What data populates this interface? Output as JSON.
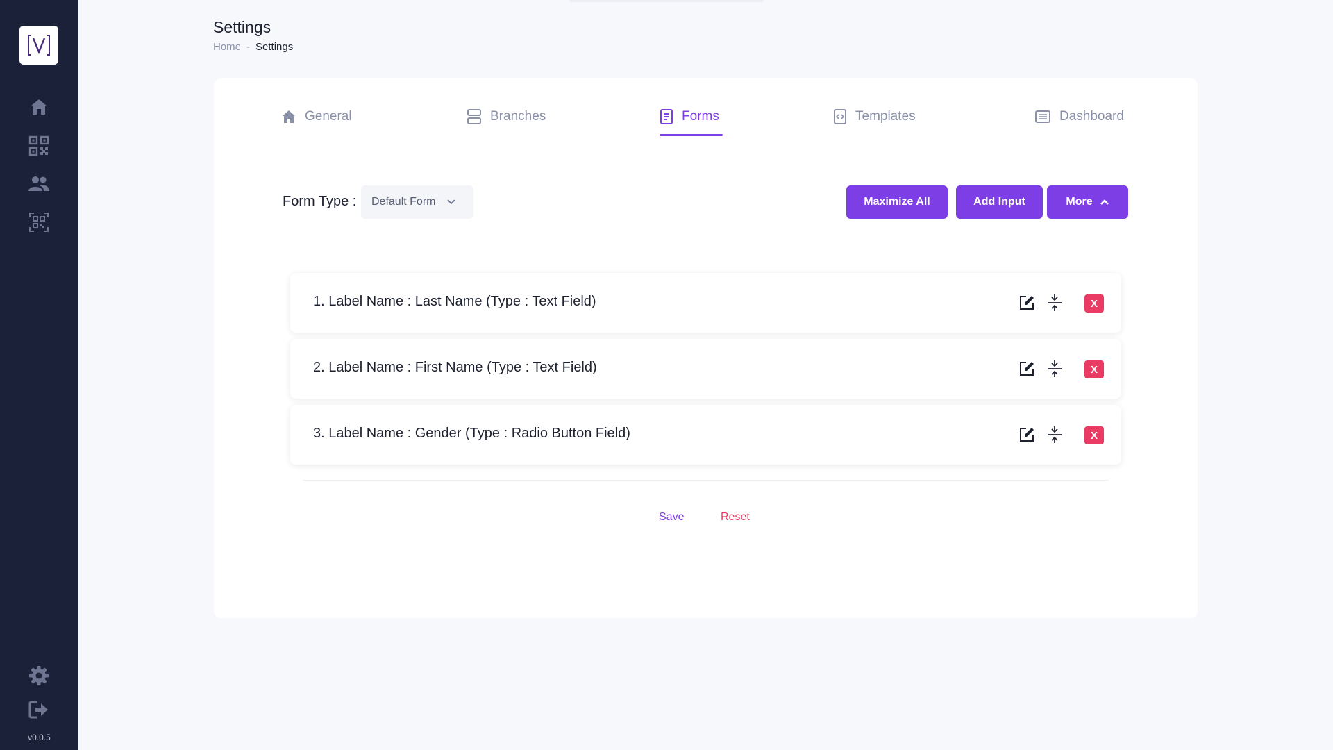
{
  "app": {
    "version": "v0.0.5"
  },
  "sidebar": {
    "icons": [
      "home-icon",
      "qr-code-icon",
      "users-icon",
      "qr-scan-icon",
      "gear-icon",
      "logout-icon"
    ]
  },
  "header": {
    "title": "Settings",
    "breadcrumb": {
      "home": "Home",
      "separator": "-",
      "current": "Settings"
    }
  },
  "tabs": [
    {
      "label": "General",
      "icon": "home-icon",
      "active": false
    },
    {
      "label": "Branches",
      "icon": "branches-icon",
      "active": false
    },
    {
      "label": "Forms",
      "icon": "document-icon",
      "active": true
    },
    {
      "label": "Templates",
      "icon": "template-icon",
      "active": false
    },
    {
      "label": "Dashboard",
      "icon": "dashboard-icon",
      "active": false
    }
  ],
  "form": {
    "type_label": "Form Type :",
    "type_value": "Default Form",
    "buttons": {
      "maximize": "Maximize All",
      "add": "Add Input",
      "more": "More"
    },
    "rows": [
      {
        "text": "1. Label Name : Last Name (Type : Text Field)"
      },
      {
        "text": "2. Label Name : First Name (Type : Text Field)"
      },
      {
        "text": "3. Label Name : Gender (Type : Radio Button Field)"
      }
    ],
    "delete_label": "X",
    "save": "Save",
    "reset": "Reset"
  },
  "colors": {
    "sidebar": "#1b2139",
    "accent": "#7e3ee6",
    "danger": "#ea3b65",
    "muted": "#8a90a8"
  }
}
